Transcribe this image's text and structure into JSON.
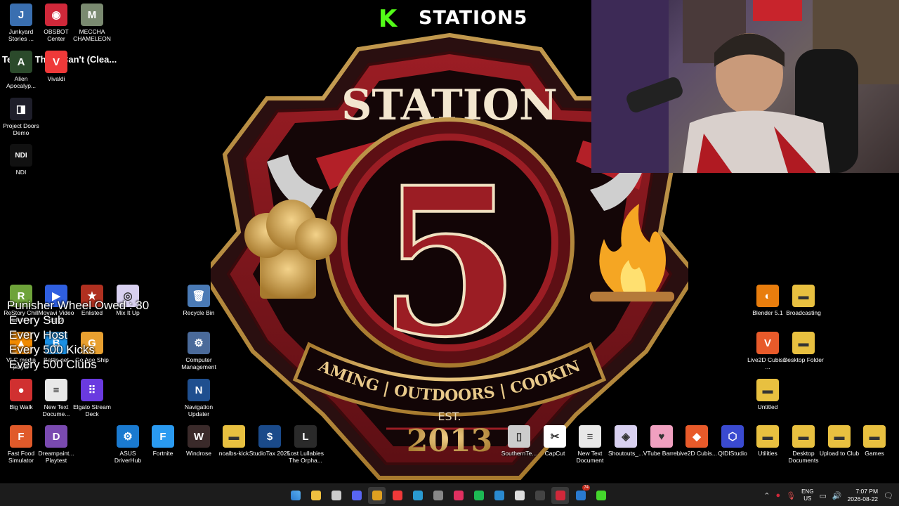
{
  "stream": {
    "kick_letter": "K",
    "title": "STATION5",
    "marquee": "Tell Me That I Can't (Clea...",
    "wheel": {
      "heading": "Punisher Wheel Owed : 30",
      "rules": [
        "Every Sub",
        "Every Host",
        "Every 500 Kicks",
        "Every 500 Clubs"
      ]
    }
  },
  "logo": {
    "top_text": "STATION",
    "number": "5",
    "est": "EST.",
    "ribbon": "GAMING | OUTDOORS | COOKING",
    "year": "2013"
  },
  "desktop_icons": [
    {
      "id": "junkyard",
      "label": "Junkyard Stories ...",
      "color": "#3a6fb0",
      "glyph": "J"
    },
    {
      "id": "obsbot",
      "label": "OBSBOT Center",
      "color": "#d0283a",
      "glyph": "◉"
    },
    {
      "id": "meccha",
      "label": "MECCHA CHAMELEON",
      "color": "#7a8a70",
      "glyph": "M"
    },
    {
      "id": "alien",
      "label": "Alien Apocalyp...",
      "color": "#2b4a2b",
      "glyph": "A"
    },
    {
      "id": "vivaldi",
      "label": "Vivaldi",
      "color": "#ef3939",
      "glyph": "V"
    },
    {
      "id": "projectdoors",
      "label": "Project Doors Demo",
      "color": "#1e1e2a",
      "glyph": "◨"
    },
    {
      "id": "ndi",
      "label": "NDI",
      "color": "#111",
      "glyph": "NDI"
    },
    {
      "id": "restory",
      "label": "ReStory Chill Elektro",
      "color": "#6ea33a",
      "glyph": "R"
    },
    {
      "id": "movavi",
      "label": "Movavi Video Editor",
      "color": "#2f5fe0",
      "glyph": "▶"
    },
    {
      "id": "enlisted",
      "label": "Enlisted",
      "color": "#b03020",
      "glyph": "★"
    },
    {
      "id": "mixitup",
      "label": "Mix It Up",
      "color": "#d8d0f0",
      "glyph": "◎"
    },
    {
      "id": "recycle",
      "label": "Recycle Bin",
      "color": "#4a7ab5",
      "glyph": "🗑"
    },
    {
      "id": "vlc",
      "label": "VLC media player",
      "color": "#f08a00",
      "glyph": "▲"
    },
    {
      "id": "battlenet",
      "label": "Battle.net",
      "color": "#1a8fe3",
      "glyph": "B"
    },
    {
      "id": "goapeship",
      "label": "Go Ape Ship",
      "color": "#e8a030",
      "glyph": "G"
    },
    {
      "id": "compmgmt",
      "label": "Computer Management",
      "color": "#4a6a9a",
      "glyph": "⚙"
    },
    {
      "id": "bigwalk",
      "label": "Big Walk",
      "color": "#d03030",
      "glyph": "●"
    },
    {
      "id": "newtext1",
      "label": "New Text Docume...",
      "color": "#e8e8e8",
      "glyph": "≡"
    },
    {
      "id": "streamdeck",
      "label": "Elgato Stream Deck",
      "color": "#6a3ae0",
      "glyph": "⠿"
    },
    {
      "id": "navupdater",
      "label": "Navigation Updater",
      "color": "#1f4f8f",
      "glyph": "N"
    },
    {
      "id": "fastfood",
      "label": "Fast Food Simulator",
      "color": "#e05a2a",
      "glyph": "F"
    },
    {
      "id": "dreampaint",
      "label": "Dreampaint... Playtest",
      "color": "#7a4ab0",
      "glyph": "D"
    },
    {
      "id": "asus",
      "label": "ASUS DriverHub",
      "color": "#1a7ad0",
      "glyph": "⚙"
    },
    {
      "id": "fortnite",
      "label": "Fortnite",
      "color": "#2a9af0",
      "glyph": "F"
    },
    {
      "id": "windrose",
      "label": "Windrose",
      "color": "#3a2a2a",
      "glyph": "W"
    },
    {
      "id": "noalbs",
      "label": "noalbs-kick",
      "color": "#e8c040",
      "glyph": "▬"
    },
    {
      "id": "studiotax",
      "label": "StudioTax 2025",
      "color": "#1a4a8a",
      "glyph": "$"
    },
    {
      "id": "lostlullabies",
      "label": "Lost Lullabies The Orpha...",
      "color": "#2a2a2a",
      "glyph": "L"
    },
    {
      "id": "blender",
      "label": "Blender 5.1",
      "color": "#e87d0d",
      "glyph": "◐"
    },
    {
      "id": "broadcasting",
      "label": "Broadcasting",
      "color": "#e8c040",
      "glyph": "▬"
    },
    {
      "id": "live2d",
      "label": "Live2D Cubism ...",
      "color": "#e85a2a",
      "glyph": "V"
    },
    {
      "id": "deskfolder",
      "label": "Desktop Folder",
      "color": "#e8c040",
      "glyph": "▬"
    },
    {
      "id": "untitled",
      "label": "Untitled",
      "color": "#e8c040",
      "glyph": "▬"
    },
    {
      "id": "southernte",
      "label": "SouthernTe...",
      "color": "#ccc",
      "glyph": "▯"
    },
    {
      "id": "capcut",
      "label": "CapCut",
      "color": "#fff",
      "glyph": "✂"
    },
    {
      "id": "newtext2",
      "label": "New Text Document",
      "color": "#e8e8e8",
      "glyph": "≡"
    },
    {
      "id": "shoutouts",
      "label": "Shoutouts_...",
      "color": "#d8d0f0",
      "glyph": "◈"
    },
    {
      "id": "vtube",
      "label": "VTube Barren",
      "color": "#f0a0c0",
      "glyph": "♥"
    },
    {
      "id": "live2dcubis",
      "label": "Live2D Cubis...",
      "color": "#e85a2a",
      "glyph": "◆"
    },
    {
      "id": "qidi",
      "label": "QIDIStudio",
      "color": "#3a4ad0",
      "glyph": "⬡"
    },
    {
      "id": "utilities",
      "label": "Utilities",
      "color": "#e8c040",
      "glyph": "▬"
    },
    {
      "id": "deskdocs",
      "label": "Desktop Documents",
      "color": "#e8c040",
      "glyph": "▬"
    },
    {
      "id": "uploadclub",
      "label": "Upload to Club",
      "color": "#e8c040",
      "glyph": "▬"
    },
    {
      "id": "games",
      "label": "Games",
      "color": "#e8c040",
      "glyph": "▬"
    }
  ],
  "taskbar": {
    "apps": [
      {
        "name": "start",
        "color": "#3a9aef"
      },
      {
        "name": "file-explorer",
        "color": "#f0c040"
      },
      {
        "name": "store",
        "color": "#cccccc"
      },
      {
        "name": "discord",
        "color": "#5865f2",
        "badge": ""
      },
      {
        "name": "chrome",
        "color": "#e0a020",
        "active": true
      },
      {
        "name": "vivaldi",
        "color": "#ef3939"
      },
      {
        "name": "edge",
        "color": "#2a9ad0"
      },
      {
        "name": "obs",
        "color": "#888"
      },
      {
        "name": "streamer-bot",
        "color": "#e03060"
      },
      {
        "name": "spotify",
        "color": "#1db954"
      },
      {
        "name": "steam-link",
        "color": "#2a8ad0"
      },
      {
        "name": "app-window",
        "color": "#ddd"
      },
      {
        "name": "bg-app",
        "color": "#444"
      },
      {
        "name": "obsbot",
        "color": "#d0283a",
        "active": true
      },
      {
        "name": "mail",
        "color": "#2a7ad0",
        "badge": "74"
      },
      {
        "name": "razer",
        "color": "#44d62c"
      }
    ],
    "lang_top": "ENG",
    "lang_bottom": "US",
    "time": "7:07 PM",
    "date": "2026-08-22"
  }
}
